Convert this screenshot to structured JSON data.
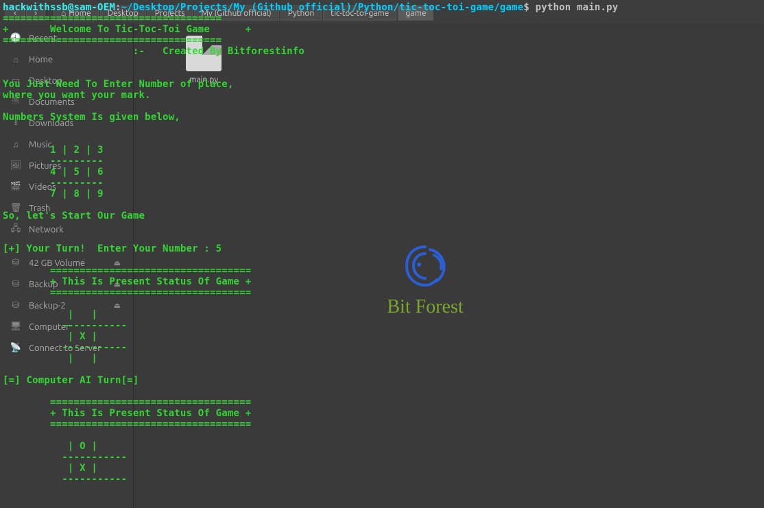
{
  "terminal": {
    "prompt_user": "hackwithssb@sam-OEM",
    "prompt_sep": ":",
    "prompt_path": "~/Desktop/Projects/My (Github official)/Python/tic-toc-toi-game/game",
    "prompt_dollar": "$ ",
    "command": "python main.py",
    "output": "\n=====================================\n+       Welcome To Tic-Toc-Toi Game      +\n=====================================\n                      :-   Created By Bitforestinfo\n\n\nYou Just Need To Enter Number of place,\nwhere you want your mark.\n\nNumbers System Is given below,\n\n\n        1 | 2 | 3\n        ---------\n        4 | 5 | 6\n        ---------\n        7 | 8 | 9\n\nSo, let's Start Our Game\n\n\n[+] Your Turn!  Enter Your Number : 5\n\n        ==================================\n        + This Is Present Status Of Game +\n        ==================================\n\n           |   | \n          -----------\n           | X | \n          -----------\n           |   | \n\n[=] Computer AI Turn[=]\n\n        ==================================\n        + This Is Present Status Of Game +\n        ==================================\n\n           | O | \n          -----------\n           | X | \n          -----------"
  },
  "filemanager": {
    "breadcrumbs": [
      "Home",
      "Desktop",
      "Projects",
      "My (Github official)",
      "Python",
      "tic-toc-toi-game",
      "game"
    ],
    "sidebar": [
      {
        "icon": "clock",
        "label": "Recent",
        "sel": false
      },
      {
        "icon": "home",
        "label": "Home",
        "sel": false
      },
      {
        "icon": "folder",
        "label": "Desktop",
        "sel": false
      },
      {
        "icon": "docs",
        "label": "Documents",
        "sel": false
      },
      {
        "icon": "download",
        "label": "Downloads",
        "sel": false
      },
      {
        "icon": "music",
        "label": "Music",
        "sel": false
      },
      {
        "icon": "pictures",
        "label": "Pictures",
        "sel": false
      },
      {
        "icon": "video",
        "label": "Videos",
        "sel": false
      },
      {
        "icon": "trash",
        "label": "Trash",
        "sel": false
      },
      {
        "icon": "network",
        "label": "Network",
        "sel": false
      },
      {
        "icon": "disk",
        "label": "42 GB Volume",
        "sel": false,
        "eject": true
      },
      {
        "icon": "disk",
        "label": "Backup",
        "sel": false,
        "eject": true
      },
      {
        "icon": "disk",
        "label": "Backup-2",
        "sel": false,
        "eject": true
      },
      {
        "icon": "computer",
        "label": "Computer",
        "sel": false
      },
      {
        "icon": "server",
        "label": "Connect to Server",
        "sel": false
      }
    ],
    "file_name": "main.py"
  },
  "watermark": {
    "text": "Bit Forest"
  }
}
